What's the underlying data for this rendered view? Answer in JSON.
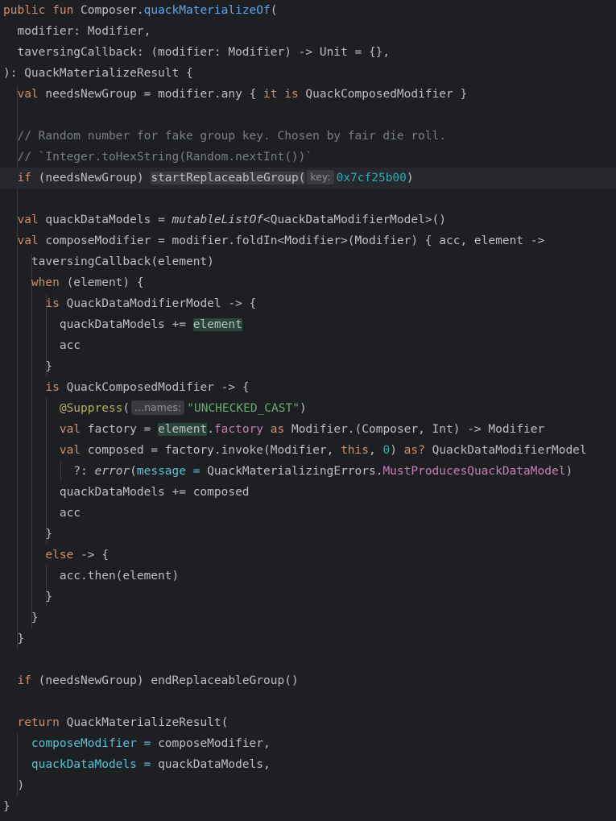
{
  "editor": {
    "theme": {
      "background": "#1e1f22",
      "default_text": "#bcbec4",
      "keyword": "#cf8e6d",
      "function_declaration": "#56a8f5",
      "comment": "#7a7e85",
      "number": "#2aacb8",
      "string": "#6aab73",
      "annotation": "#b3ae60",
      "property": "#c77dbb",
      "named_argument": "#56c1d6",
      "inlay_hint_bg": "#393b40",
      "usage_highlight_bg": "#29453b",
      "current_line_bg": "#26282e"
    },
    "current_line_index": 8,
    "lines": [
      [
        {
          "t": "public fun ",
          "c": "kw"
        },
        {
          "t": "Composer."
        },
        {
          "t": "quackMaterializeOf",
          "c": "fn"
        },
        {
          "t": "("
        }
      ],
      [
        {
          "t": "  modifier: Modifier,"
        }
      ],
      [
        {
          "t": "  taversingCallback: (modifier: Modifier) -> Unit = {},"
        }
      ],
      [
        {
          "t": "): QuackMaterializeResult {"
        }
      ],
      [
        {
          "t": "  "
        },
        {
          "t": "val",
          "c": "kw"
        },
        {
          "t": " needsNewGroup = modifier.any { "
        },
        {
          "t": "it",
          "c": "kw"
        },
        {
          "t": " "
        },
        {
          "t": "is",
          "c": "kw"
        },
        {
          "t": " QuackComposedModifier }"
        }
      ],
      [],
      [
        {
          "t": "  // Random number for fake group key. Chosen by fair die roll.",
          "c": "cm"
        }
      ],
      [
        {
          "t": "  // `Integer.toHexString(Random.nextInt())`",
          "c": "cm"
        }
      ],
      [
        {
          "t": "  "
        },
        {
          "t": "if",
          "c": "kw"
        },
        {
          "t": " (needsNewGroup) "
        },
        {
          "t": "startReplaceableGroup(",
          "c": "hl-bg"
        },
        {
          "hint": "key:"
        },
        {
          "t": "0x7cf25b00",
          "c": "num"
        },
        {
          "t": ")"
        }
      ],
      [],
      [
        {
          "t": "  "
        },
        {
          "t": "val",
          "c": "kw"
        },
        {
          "t": " quackDataModels = "
        },
        {
          "t": "mutableListOf",
          "c": "italic"
        },
        {
          "t": "<QuackDataModifierModel>()"
        }
      ],
      [
        {
          "t": "  "
        },
        {
          "t": "val",
          "c": "kw"
        },
        {
          "t": " composeModifier = modifier.foldIn<Modifier>(Modifier) { acc, element ->"
        }
      ],
      [
        {
          "t": "    taversingCallback(element)"
        }
      ],
      [
        {
          "t": "    "
        },
        {
          "t": "when",
          "c": "kw"
        },
        {
          "t": " (element) {"
        }
      ],
      [
        {
          "t": "      "
        },
        {
          "t": "is",
          "c": "kw"
        },
        {
          "t": " QuackDataModifierModel -> {"
        }
      ],
      [
        {
          "t": "        quackDataModels += "
        },
        {
          "t": "element",
          "c": "hl-green"
        }
      ],
      [
        {
          "t": "        acc"
        }
      ],
      [
        {
          "t": "      }"
        }
      ],
      [
        {
          "t": "      "
        },
        {
          "t": "is",
          "c": "kw"
        },
        {
          "t": " QuackComposedModifier -> {"
        }
      ],
      [
        {
          "t": "        "
        },
        {
          "t": "@Suppress",
          "c": "ann"
        },
        {
          "t": "("
        },
        {
          "hint": "...names:"
        },
        {
          "t": "\"UNCHECKED_CAST\"",
          "c": "str"
        },
        {
          "t": ")"
        }
      ],
      [
        {
          "t": "        "
        },
        {
          "t": "val",
          "c": "kw"
        },
        {
          "t": " factory = "
        },
        {
          "t": "element",
          "c": "hl-green"
        },
        {
          "t": "."
        },
        {
          "t": "factory",
          "c": "prop"
        },
        {
          "t": " "
        },
        {
          "t": "as",
          "c": "kw"
        },
        {
          "t": " Modifier.(Composer, Int) -> Modifier"
        }
      ],
      [
        {
          "t": "        "
        },
        {
          "t": "val",
          "c": "kw"
        },
        {
          "t": " composed = factory.invoke(Modifier, "
        },
        {
          "t": "this",
          "c": "kw"
        },
        {
          "t": ", "
        },
        {
          "t": "0",
          "c": "num"
        },
        {
          "t": ") "
        },
        {
          "t": "as?",
          "c": "kw"
        },
        {
          "t": " QuackDataModifierModel"
        }
      ],
      [
        {
          "t": "          ?: "
        },
        {
          "t": "error",
          "c": "italic"
        },
        {
          "t": "("
        },
        {
          "t": "message = ",
          "c": "named"
        },
        {
          "t": "QuackMaterializingErrors."
        },
        {
          "t": "MustProducesQuackDataModel",
          "c": "prop"
        },
        {
          "t": ")"
        }
      ],
      [
        {
          "t": "        quackDataModels += composed"
        }
      ],
      [
        {
          "t": "        acc"
        }
      ],
      [
        {
          "t": "      }"
        }
      ],
      [
        {
          "t": "      "
        },
        {
          "t": "else",
          "c": "kw"
        },
        {
          "t": " -> {"
        }
      ],
      [
        {
          "t": "        acc.then(element)"
        }
      ],
      [
        {
          "t": "      }"
        }
      ],
      [
        {
          "t": "    }"
        }
      ],
      [
        {
          "t": "  }"
        }
      ],
      [],
      [
        {
          "t": "  "
        },
        {
          "t": "if",
          "c": "kw"
        },
        {
          "t": " (needsNewGroup) endReplaceableGroup()"
        }
      ],
      [],
      [
        {
          "t": "  "
        },
        {
          "t": "return",
          "c": "kw"
        },
        {
          "t": " QuackMaterializeResult("
        }
      ],
      [
        {
          "t": "    "
        },
        {
          "t": "composeModifier = ",
          "c": "named"
        },
        {
          "t": "composeModifier,"
        }
      ],
      [
        {
          "t": "    "
        },
        {
          "t": "quackDataModels = ",
          "c": "named"
        },
        {
          "t": "quackDataModels,"
        }
      ],
      [
        {
          "t": "  )"
        }
      ],
      [
        {
          "t": "}"
        }
      ]
    ]
  }
}
